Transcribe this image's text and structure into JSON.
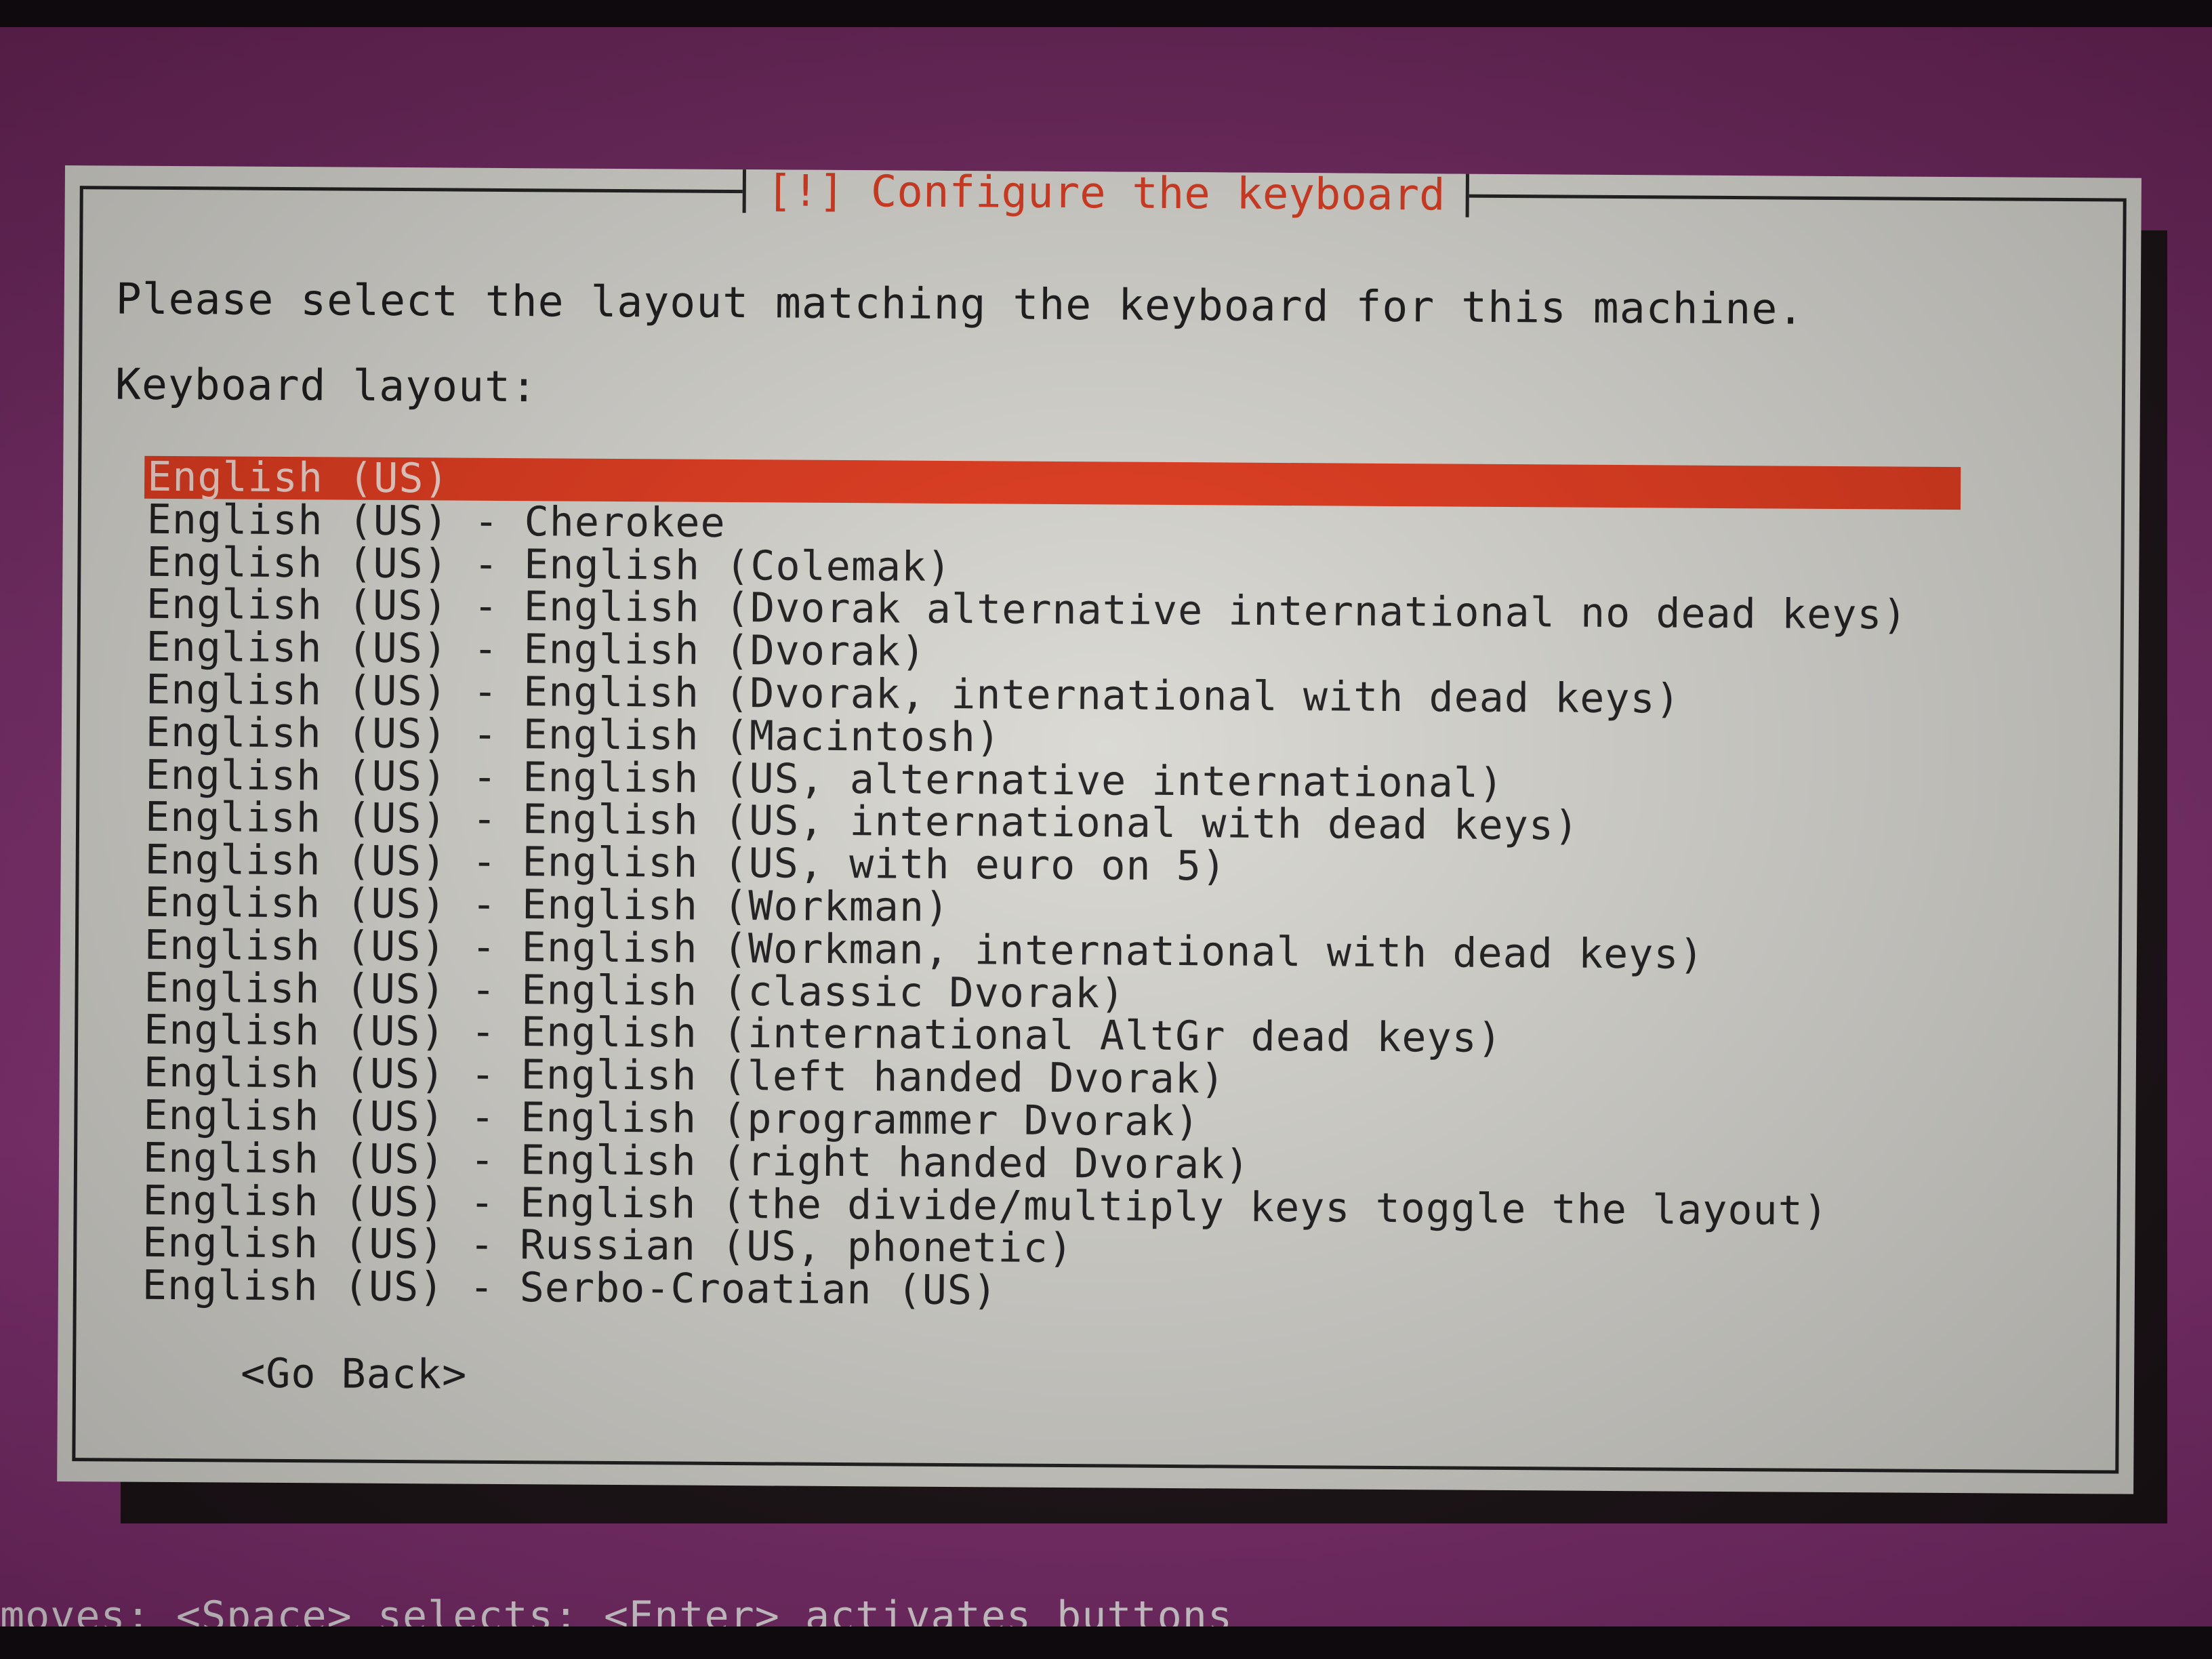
{
  "dialog": {
    "title": "[!] Configure the keyboard",
    "prompt": "Please select the layout matching the keyboard for this machine.",
    "list_label": "Keyboard layout:",
    "layouts": [
      "English (US)",
      "English (US) - Cherokee",
      "English (US) - English (Colemak)",
      "English (US) - English (Dvorak alternative international no dead keys)",
      "English (US) - English (Dvorak)",
      "English (US) - English (Dvorak, international with dead keys)",
      "English (US) - English (Macintosh)",
      "English (US) - English (US, alternative international)",
      "English (US) - English (US, international with dead keys)",
      "English (US) - English (US, with euro on 5)",
      "English (US) - English (Workman)",
      "English (US) - English (Workman, international with dead keys)",
      "English (US) - English (classic Dvorak)",
      "English (US) - English (international AltGr dead keys)",
      "English (US) - English (left handed Dvorak)",
      "English (US) - English (programmer Dvorak)",
      "English (US) - English (right handed Dvorak)",
      "English (US) - English (the divide/multiply keys toggle the layout)",
      "English (US) - Russian (US, phonetic)",
      "English (US) - Serbo-Croatian (US)"
    ],
    "selected_layout": "English (US)",
    "go_back_label": "<Go Back>"
  },
  "status_bar": {
    "text": "moves; <Space> selects; <Enter> activates buttons"
  },
  "colors": {
    "background": "#7e2f6e",
    "dialog": "#d9d8d2",
    "accent": "#e2391c",
    "title": "#dc3a1f",
    "text": "#1e1e1e"
  }
}
